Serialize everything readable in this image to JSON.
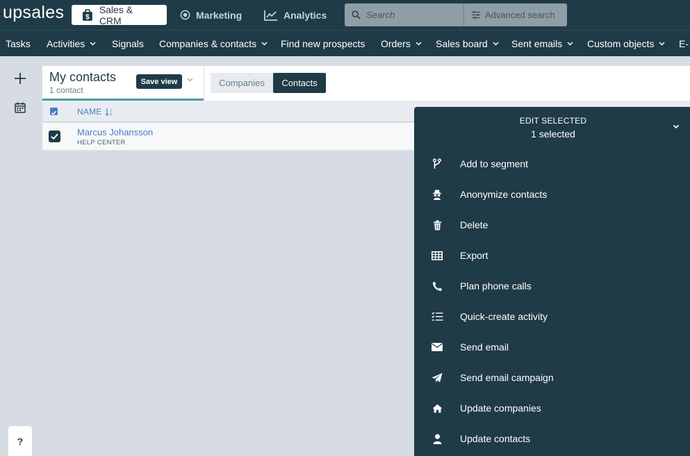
{
  "topbar": {
    "logo": "upsales",
    "apps": [
      {
        "label": "Sales & CRM",
        "icon": "sales-bag-icon"
      },
      {
        "label": "Marketing",
        "icon": "target-icon"
      },
      {
        "label": "Analytics",
        "icon": "chart-line-icon"
      }
    ],
    "search_placeholder": "Search",
    "advanced_search_label": "Advanced search"
  },
  "nav": {
    "items": [
      {
        "label": "Tasks"
      },
      {
        "label": "Activities"
      },
      {
        "label": "Signals"
      },
      {
        "label": "Companies & contacts"
      },
      {
        "label": "Find new prospects"
      },
      {
        "label": "Orders"
      },
      {
        "label": "Sales board"
      },
      {
        "label": "Sent emails"
      },
      {
        "label": "Custom objects"
      },
      {
        "label": "E-"
      }
    ]
  },
  "view": {
    "title": "My contacts",
    "count": "1 contact",
    "save_label": "Save view"
  },
  "tabs": {
    "companies": "Companies",
    "contacts": "Contacts"
  },
  "table": {
    "name_header": "NAME",
    "rows": [
      {
        "name": "Marcus Johansson",
        "company": "HELP CENTER",
        "checked": true
      }
    ]
  },
  "edit_panel": {
    "title": "EDIT SELECTED",
    "subtitle": "1 selected",
    "actions": [
      {
        "label": "Add to segment",
        "icon": "segment-branch-icon"
      },
      {
        "label": "Anonymize contacts",
        "icon": "spy-icon"
      },
      {
        "label": "Delete",
        "icon": "trash-icon"
      },
      {
        "label": "Export",
        "icon": "table-icon"
      },
      {
        "label": "Plan phone calls",
        "icon": "phone-icon"
      },
      {
        "label": "Quick-create activity",
        "icon": "checklist-icon"
      },
      {
        "label": "Send email",
        "icon": "envelope-icon"
      },
      {
        "label": "Send email campaign",
        "icon": "paper-plane-icon"
      },
      {
        "label": "Update companies",
        "icon": "home-icon"
      },
      {
        "label": "Update contacts",
        "icon": "user-icon"
      }
    ]
  },
  "help_label": "?",
  "colors": {
    "primary": "#1f3b47",
    "accent": "#4a7fc1",
    "teal": "#4a9aa5",
    "background": "#d7dce4"
  }
}
